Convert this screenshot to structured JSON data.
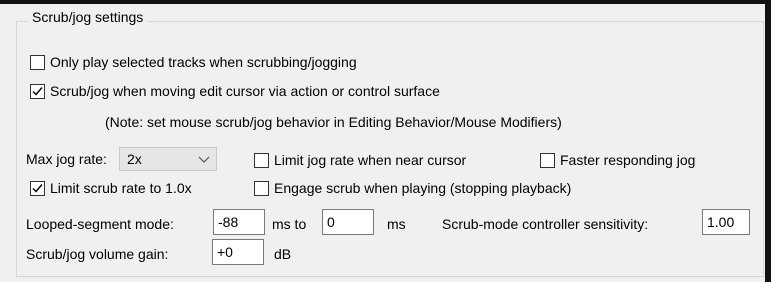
{
  "group": {
    "title": "Scrub/jog settings"
  },
  "options": {
    "only_selected": {
      "label": "Only play selected tracks when scrubbing/jogging",
      "checked": false
    },
    "scrub_edit_cursor": {
      "label": "Scrub/jog when moving edit cursor via action or control surface",
      "checked": true
    },
    "note": "(Note: set mouse scrub/jog behavior in Editing Behavior/Mouse Modifiers)",
    "limit_jog_near_cursor": {
      "label": "Limit jog rate when near cursor",
      "checked": false
    },
    "faster_jog": {
      "label": "Faster responding jog",
      "checked": false
    },
    "limit_scrub_rate": {
      "label": "Limit scrub rate to 1.0x",
      "checked": true
    },
    "engage_scrub_playing": {
      "label": "Engage scrub when playing (stopping playback)",
      "checked": false
    }
  },
  "max_jog": {
    "label": "Max jog rate:",
    "value": "2x"
  },
  "looped": {
    "label": "Looped-segment mode:",
    "from": "-88",
    "mid": "ms to",
    "to": "0",
    "unit": "ms"
  },
  "sensitivity": {
    "label": "Scrub-mode controller sensitivity:",
    "value": "1.00"
  },
  "volume": {
    "label": "Scrub/jog volume gain:",
    "value": "+0",
    "unit": "dB"
  },
  "icons": {
    "check": "checkmark-icon",
    "chevron": "chevron-down-icon"
  }
}
